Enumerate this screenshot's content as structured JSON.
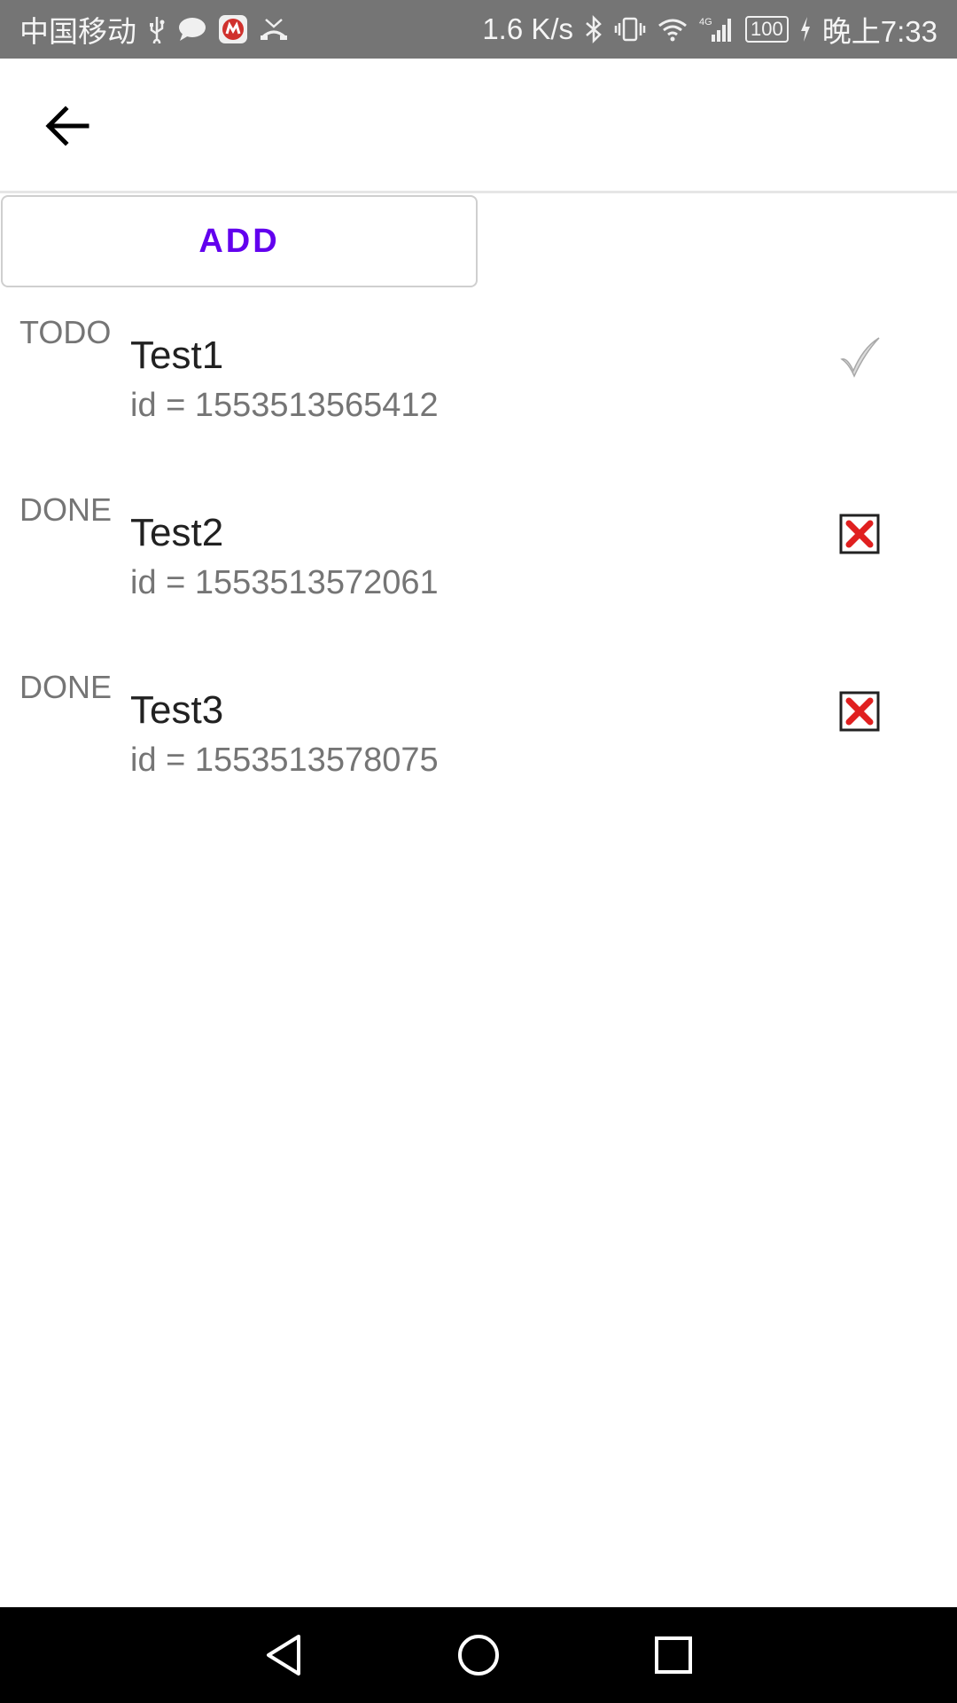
{
  "status_bar": {
    "carrier": "中国移动",
    "speed": "1.6 K/s",
    "network": "4G",
    "battery": "100",
    "time": "晚上7:33"
  },
  "toolbar": {
    "back_icon": "arrow-back-icon"
  },
  "add_button": {
    "label": "ADD"
  },
  "items": [
    {
      "status": "TODO",
      "title": "Test1",
      "id_text": "id = 1553513565412",
      "action_icon": "checkmark-icon"
    },
    {
      "status": "DONE",
      "title": "Test2",
      "id_text": "id = 1553513572061",
      "action_icon": "delete-x-icon"
    },
    {
      "status": "DONE",
      "title": "Test3",
      "id_text": "id = 1553513578075",
      "action_icon": "delete-x-icon"
    }
  ],
  "colors": {
    "accent": "#6200ee",
    "status_bar": "#757575",
    "delete_red": "#e02020"
  }
}
